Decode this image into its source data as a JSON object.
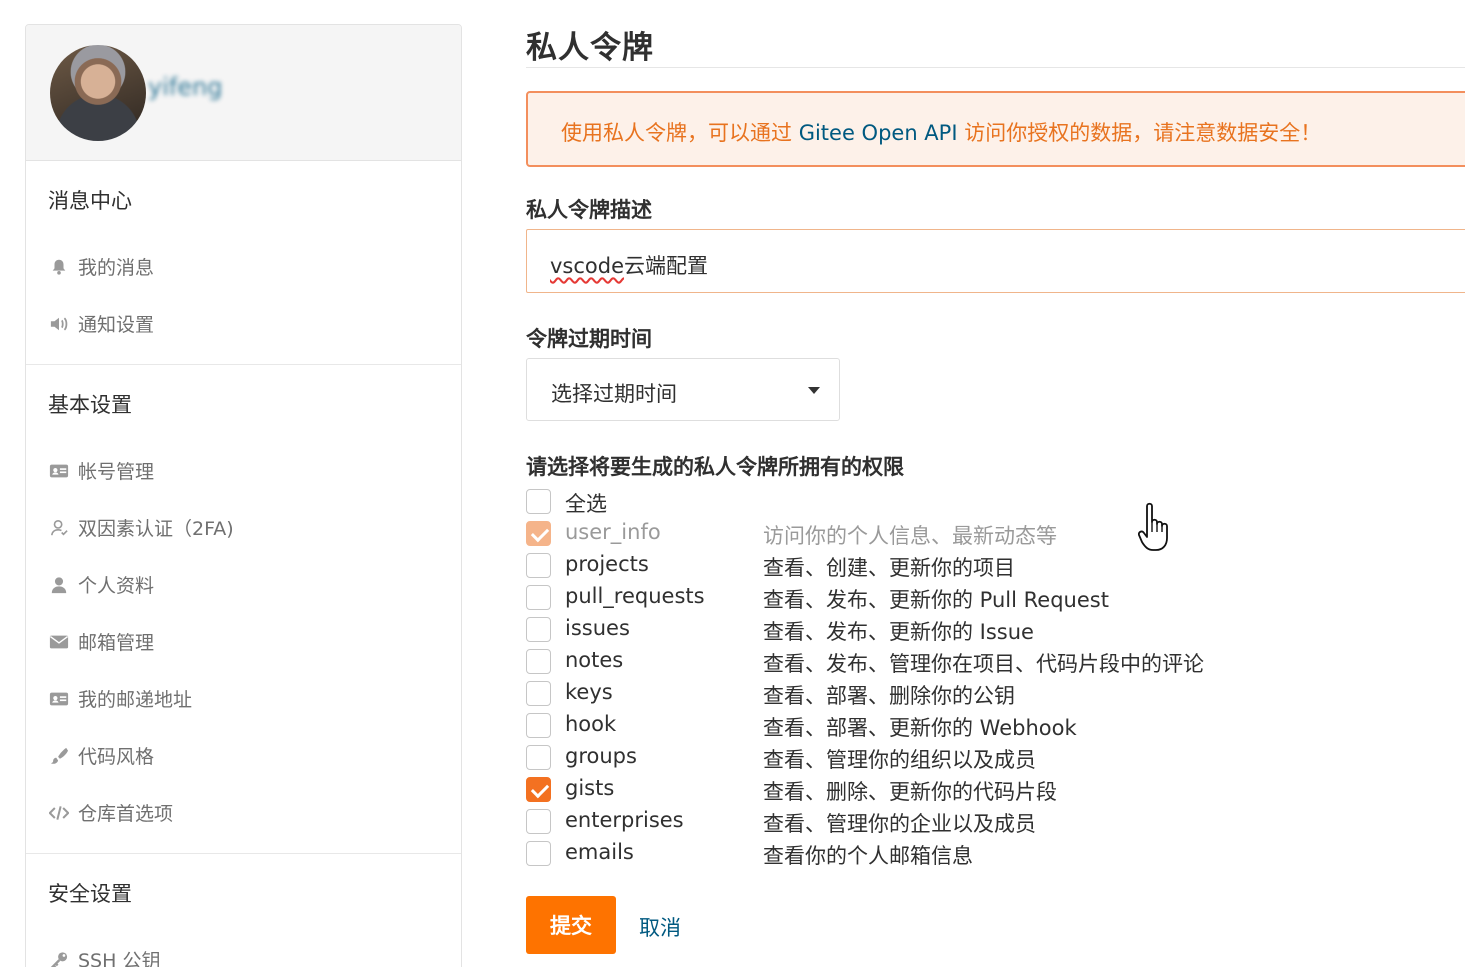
{
  "sidebar": {
    "username": "yifeng",
    "sections": [
      {
        "title": "消息中心",
        "items": [
          {
            "label": "我的消息",
            "icon": "bell-icon"
          },
          {
            "label": "通知设置",
            "icon": "speaker-icon"
          }
        ]
      },
      {
        "title": "基本设置",
        "items": [
          {
            "label": "帐号管理",
            "icon": "id-card-icon"
          },
          {
            "label": "双因素认证（2FA)",
            "icon": "user-outline-icon"
          },
          {
            "label": "个人资料",
            "icon": "user-icon"
          },
          {
            "label": "邮箱管理",
            "icon": "envelope-icon"
          },
          {
            "label": "我的邮递地址",
            "icon": "address-card-icon"
          },
          {
            "label": "代码风格",
            "icon": "brush-icon"
          },
          {
            "label": "仓库首选项",
            "icon": "code-icon"
          }
        ]
      },
      {
        "title": "安全设置",
        "items": [
          {
            "label": "SSH 公钥",
            "icon": "key-icon"
          }
        ]
      }
    ]
  },
  "main": {
    "title": "私人令牌",
    "alert": {
      "prefix": "使用私人令牌，可以通过 ",
      "highlight": "Gitee Open API",
      "suffix": " 访问你授权的数据，请注意数据安全！"
    },
    "description_label": "私人令牌描述",
    "description_value_misspelled": "vscode",
    "description_value_rest": "云端配置",
    "expiry_label": "令牌过期时间",
    "expiry_selected": "选择过期时间",
    "permissions_label": "请选择将要生成的私人令牌所拥有的权限",
    "select_all_label": "全选",
    "permissions": [
      {
        "name": "user_info",
        "desc": "访问你的个人信息、最新动态等",
        "checked": true,
        "disabled": true
      },
      {
        "name": "projects",
        "desc": "查看、创建、更新你的项目",
        "checked": false
      },
      {
        "name": "pull_requests",
        "desc": "查看、发布、更新你的 Pull Request",
        "checked": false
      },
      {
        "name": "issues",
        "desc": "查看、发布、更新你的 Issue",
        "checked": false
      },
      {
        "name": "notes",
        "desc": "查看、发布、管理你在项目、代码片段中的评论",
        "checked": false
      },
      {
        "name": "keys",
        "desc": "查看、部署、删除你的公钥",
        "checked": false
      },
      {
        "name": "hook",
        "desc": "查看、部署、更新你的 Webhook",
        "checked": false
      },
      {
        "name": "groups",
        "desc": "查看、管理你的组织以及成员",
        "checked": false
      },
      {
        "name": "gists",
        "desc": "查看、删除、更新你的代码片段",
        "checked": true
      },
      {
        "name": "enterprises",
        "desc": "查看、管理你的企业以及成员",
        "checked": false
      },
      {
        "name": "emails",
        "desc": "查看你的个人邮箱信息",
        "checked": false
      }
    ],
    "submit_label": "提交",
    "cancel_label": "取消",
    "colors": {
      "accent": "#fe7300",
      "link": "#005980",
      "alert_bg": "#fdf1e9",
      "alert_border": "#f38f5d"
    }
  }
}
